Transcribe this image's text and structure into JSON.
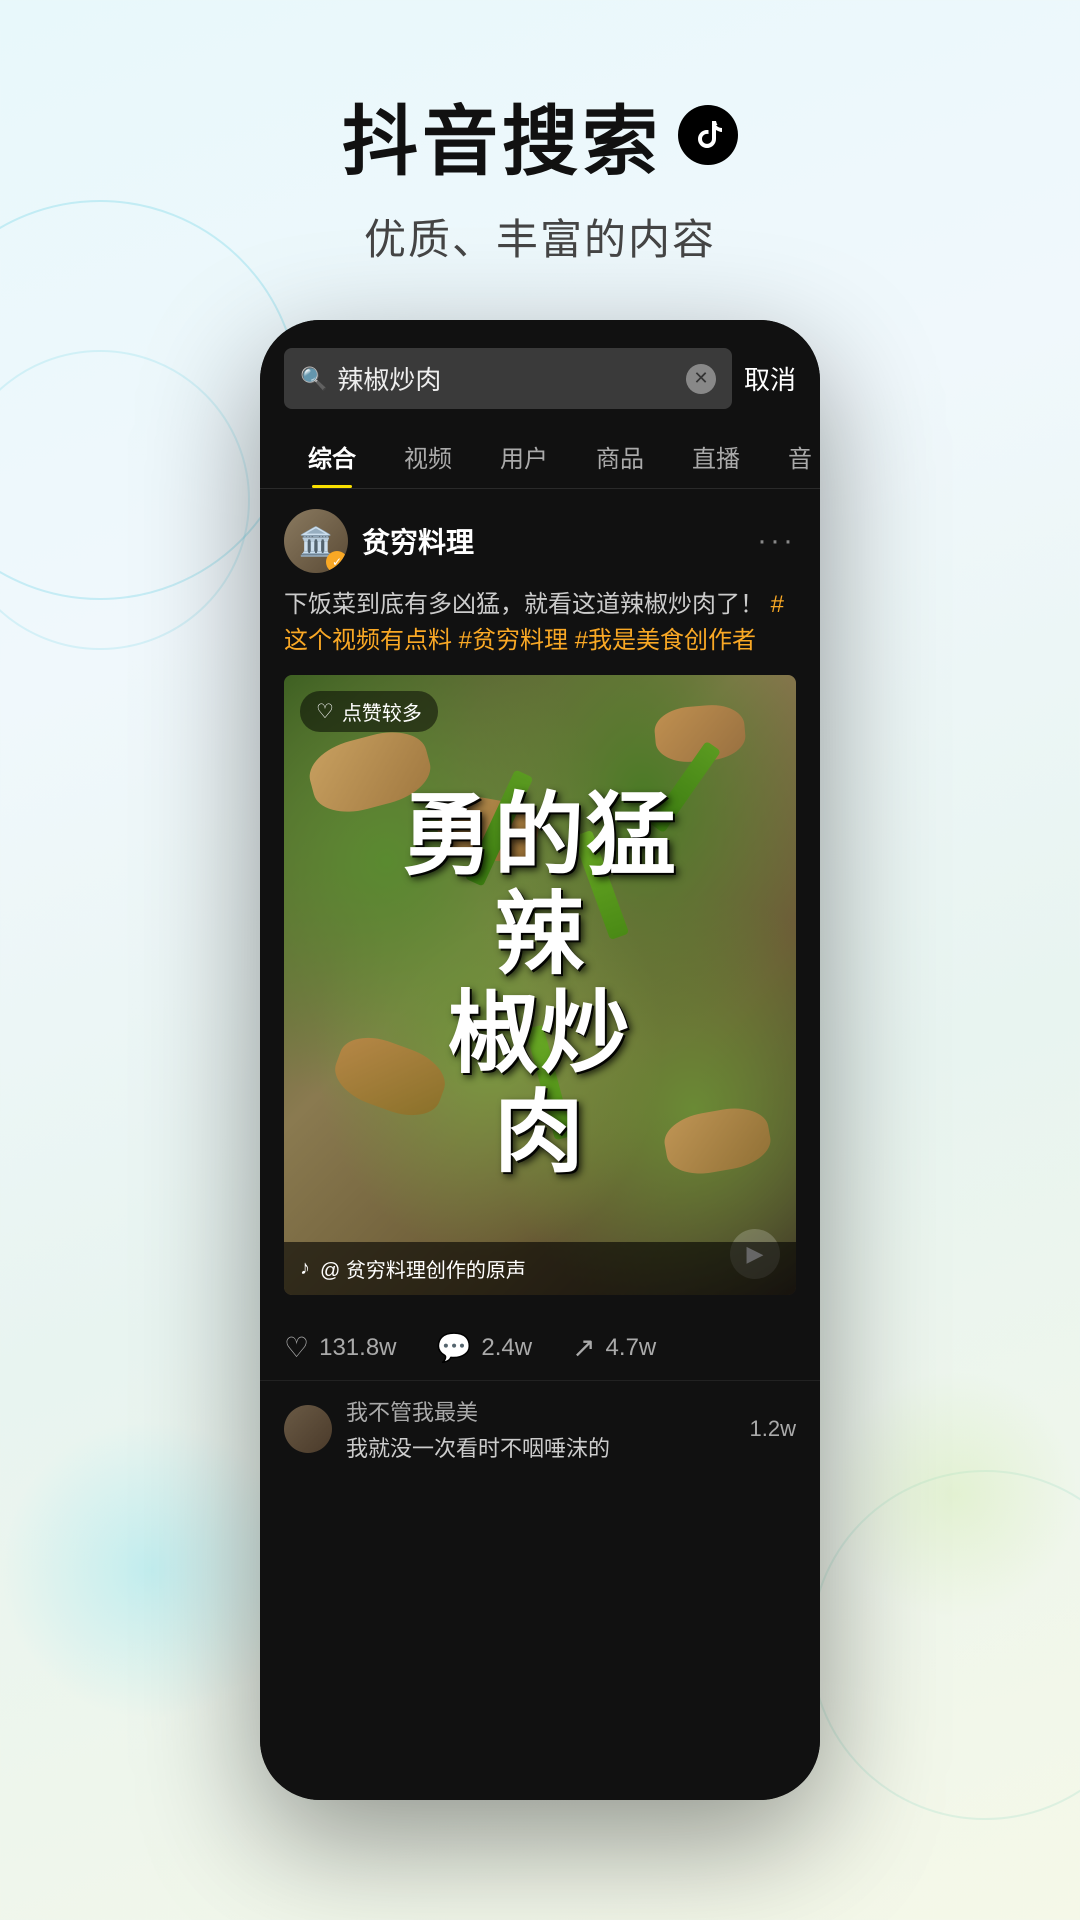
{
  "header": {
    "title": "抖音搜索",
    "logo_symbol": "♪",
    "subtitle": "优质、丰富的内容"
  },
  "phone": {
    "search": {
      "query": "辣椒炒肉",
      "cancel_label": "取消"
    },
    "tabs": [
      {
        "id": "comprehensive",
        "label": "综合",
        "active": true
      },
      {
        "id": "video",
        "label": "视频",
        "active": false
      },
      {
        "id": "user",
        "label": "用户",
        "active": false
      },
      {
        "id": "product",
        "label": "商品",
        "active": false
      },
      {
        "id": "live",
        "label": "直播",
        "active": false
      },
      {
        "id": "music",
        "label": "音",
        "active": false
      }
    ],
    "result_card": {
      "username": "贫穷料理",
      "verified": true,
      "post_text": "下饭菜到底有多凶猛，就看这道辣椒炒肉了！",
      "hashtags": [
        "#这个视频有点料",
        "#贫穷料理",
        "#我是美食创作者"
      ],
      "likes_badge": "点赞较多",
      "video_text": "勇的猛辣椒炒肉",
      "video_text_lines": [
        "勇",
        "的猛",
        "辣",
        "椒炒",
        "肉"
      ],
      "source_label": "@ 贫穷料理创作的原声",
      "stats": {
        "likes": "131.8w",
        "comments": "2.4w",
        "shares": "4.7w"
      },
      "comment_preview": {
        "user": "我不管我最美",
        "text": "我就没一次看时不咽唾沫的",
        "count": "1.2w"
      }
    }
  }
}
